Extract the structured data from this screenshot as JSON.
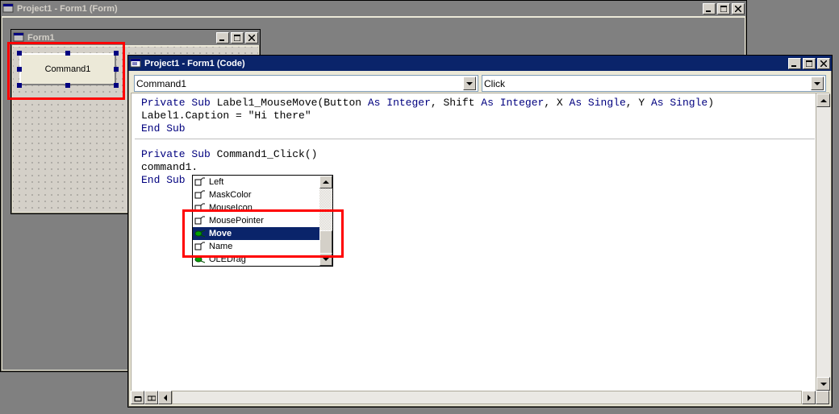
{
  "mdi": {
    "title": "Project1 - Form1 (Form)"
  },
  "form_designer": {
    "title": "Form1",
    "command_button_caption": "Command1"
  },
  "code_window": {
    "title": "Project1 - Form1 (Code)",
    "object_combo": "Command1",
    "procedure_combo": "Click",
    "code_lines": [
      {
        "kw": "Private Sub ",
        "plain": "Label1_MouseMove(Button ",
        "kw2": "As Integer",
        "plain2": ", Shift ",
        "kw3": "As Integer",
        "plain3": ", X ",
        "kw4": "As Single",
        "plain4": ", Y ",
        "kw5": "As Single",
        "plain5": ")"
      },
      {
        "plain": "Label1.Caption = \"Hi there\""
      },
      {
        "kw": "End Sub"
      },
      {
        "plain": ""
      },
      {
        "kw": "Private Sub ",
        "plain": "Command1_Click()"
      },
      {
        "plain": "command1."
      },
      {
        "kw": "End Sub"
      }
    ]
  },
  "intellisense": {
    "items": [
      {
        "icon": "property",
        "label": "Left"
      },
      {
        "icon": "property",
        "label": "MaskColor"
      },
      {
        "icon": "property",
        "label": "MouseIcon"
      },
      {
        "icon": "property",
        "label": "MousePointer"
      },
      {
        "icon": "method",
        "label": "Move",
        "selected": true
      },
      {
        "icon": "property",
        "label": "Name"
      },
      {
        "icon": "method",
        "label": "OLEDrag"
      }
    ]
  }
}
